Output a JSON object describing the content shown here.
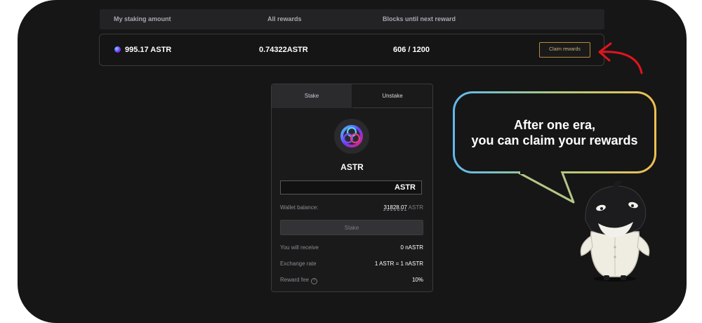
{
  "header": {
    "staking_amount": "My staking amount",
    "all_rewards": "All rewards",
    "blocks_until": "Blocks until next reward"
  },
  "summary": {
    "staking_amount": "995.17 ASTR",
    "all_rewards": "0.74322ASTR",
    "blocks": "606 / 1200",
    "claim_label": "Claim rewards"
  },
  "panel": {
    "tabs": [
      "Stake",
      "Unstake"
    ],
    "token_name": "ASTR",
    "amount_value": "ASTR",
    "wallet_balance_label": "Wallet balance:",
    "wallet_balance_value": "31828.07",
    "wallet_balance_unit": "ASTR",
    "stake_label": "Stake",
    "receive_label": "You will receive",
    "receive_value": "0 nASTR",
    "rate_label": "Exchange rate",
    "rate_value": "1 ASTR = 1 nASTR",
    "fee_label": "Reward fee",
    "fee_help": "?",
    "fee_value": "10%"
  },
  "callout": {
    "line1": "After one era,",
    "line2": "you can claim your rewards"
  },
  "colors": {
    "background": "#161616",
    "accent_gold": "#b78b3e",
    "arrow_red": "#e2141d"
  }
}
